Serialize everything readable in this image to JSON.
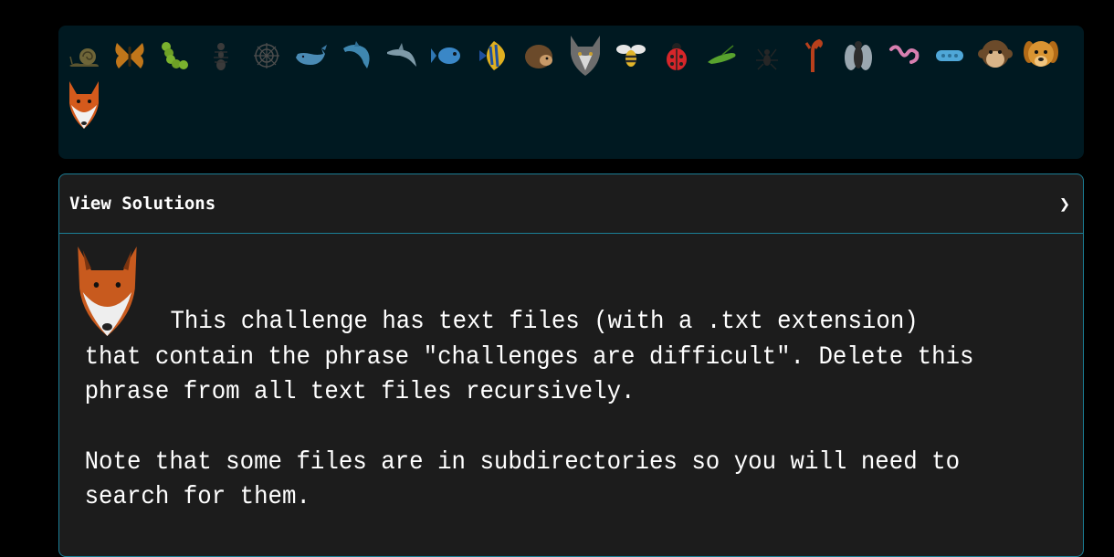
{
  "animals": [
    {
      "name": "snail-icon",
      "label": "Snail"
    },
    {
      "name": "butterfly-icon",
      "label": "Butterfly"
    },
    {
      "name": "caterpillar-icon",
      "label": "Caterpillar"
    },
    {
      "name": "ant-icon",
      "label": "Ant"
    },
    {
      "name": "spider-web-icon",
      "label": "Spider web"
    },
    {
      "name": "whale-icon",
      "label": "Whale"
    },
    {
      "name": "dolphin-icon",
      "label": "Dolphin"
    },
    {
      "name": "shark-icon",
      "label": "Shark"
    },
    {
      "name": "fish-icon",
      "label": "Fish"
    },
    {
      "name": "tropical-fish-icon",
      "label": "Tropical fish"
    },
    {
      "name": "hedgehog-icon",
      "label": "Hedgehog"
    },
    {
      "name": "wolf-icon",
      "label": "Wolf"
    },
    {
      "name": "bee-icon",
      "label": "Bee"
    },
    {
      "name": "ladybug-icon",
      "label": "Ladybug"
    },
    {
      "name": "cricket-icon",
      "label": "Cricket"
    },
    {
      "name": "spider-icon",
      "label": "Spider"
    },
    {
      "name": "scorpion-icon",
      "label": "Scorpion"
    },
    {
      "name": "fly-icon",
      "label": "Fly"
    },
    {
      "name": "worm-icon",
      "label": "Worm"
    },
    {
      "name": "microbe-icon",
      "label": "Microbe"
    },
    {
      "name": "monkey-icon",
      "label": "Monkey"
    },
    {
      "name": "dog-icon",
      "label": "Dog"
    },
    {
      "name": "fox-icon",
      "label": "Fox"
    }
  ],
  "solutions": {
    "title": "View Solutions",
    "chevron": "❯"
  },
  "challenge": {
    "paragraph1": "This challenge has text files (with a .txt extension) that contain the phrase \"challenges are difficult\". Delete this phrase from all text files recursively.",
    "paragraph2": "Note that some files are in subdirectories so you will need to search for them."
  },
  "colors": {
    "page_bg": "#000000",
    "animal_bar_bg": "#001921",
    "panel_bg": "#1c1c1c",
    "panel_border": "#1b7e96",
    "text": "#ffffff"
  }
}
